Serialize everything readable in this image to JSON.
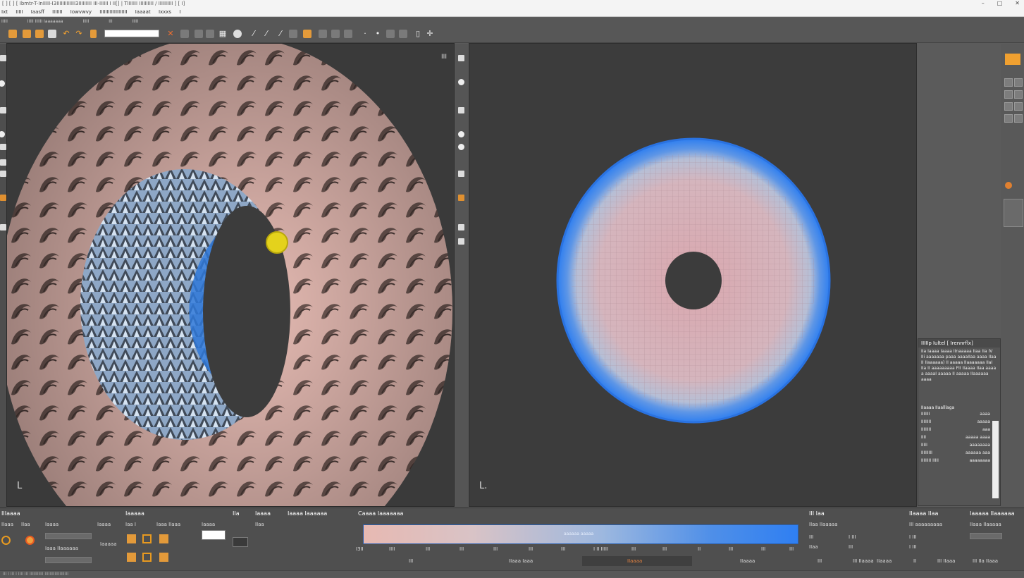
{
  "window": {
    "title": "[ ] [ ] [ Ibmtr-T-InIIIII-I3IIIIIIIIIIIII3IIIIIIIII III-IIIIII I II[] | TIIIIIII IIIIIIIIII / IIIIIIIIII ] [ I]",
    "controls": [
      "–",
      "□",
      "✕"
    ]
  },
  "menubar": [
    "Ixt",
    "IIIII",
    "Iaasff",
    "IIIIIII",
    "Iowvwvy",
    "IIIIIIIIIIIIIIIIIII",
    "Iaaaat",
    "Ixxxs",
    "I"
  ],
  "shelf_tabs": [
    "IIIII",
    "IIIII IIIIII Iaaaaaaa",
    "IIIII",
    "III",
    "IIIII"
  ],
  "toolbar_icons": [
    "folder-icon",
    "save-icon",
    "undo-icon",
    "redo-icon",
    "grid-icon",
    "magnet-icon",
    "pen-icon",
    "lock-icon",
    "camera-icon",
    "move-icon"
  ],
  "viewport_left": {
    "axis_label": "L",
    "persp_label": "III"
  },
  "viewport_right": {
    "axis_label": "L."
  },
  "help_panel": {
    "title": "IIIIIp Iultel [ Irennrflx]",
    "text": "IIa Iaaaa Iaaaa IInaaaaa IIaa IIa IV IIi aaaaaaa paaa aaaaIIaa aaaa IIaa II IIaaaaaa) II aaaaa IIaaaaaaa IIaI IIa II aaaaaaaaa FII IIaaaa IIaa aaaa a aaaaI aaaaa II aaaaa IIaaaaaa aaaa",
    "sub_title": "IIaaaa IIaalllaga",
    "rows": [
      {
        "k": "IIIIIII",
        "v": "aaaa"
      },
      {
        "k": "IIIIIIII",
        "v": "aaaaa"
      },
      {
        "k": "IIIIIIII",
        "v": "aaa"
      },
      {
        "k": "IIII",
        "v": "aaaaa aaaa"
      },
      {
        "k": "IIIII",
        "v": "aaaaaaaa"
      },
      {
        "k": "IIIIIIIII",
        "v": "aaaaaa aaa"
      },
      {
        "k": "IIIIIIII IIIII",
        "v": "aaaaaaaa"
      }
    ]
  },
  "bottom": {
    "sections": [
      "IIIaaaa",
      "Iaaaaa",
      "IIa",
      "Iaaaa",
      "Iaaaa Iaaaaaa",
      "Caaaa Iaaaaaaa",
      "III Iaa",
      "IIaaaa IIaa",
      "Iaaaaa IIaaaaaa"
    ],
    "labels_left": [
      "IIaaa",
      "IIaa",
      "Iaaaa",
      "Iaaaa",
      "Iaaa IIaaaaaa",
      "Iaaaaa",
      "Iaa I",
      "Iaaa IIaaa",
      "Iaaaa",
      "IIaa"
    ],
    "gradient_label": "aaaaaa aaaaa",
    "ticks": [
      "I3II",
      "IIII",
      "III",
      "III",
      "III",
      "III",
      "III",
      "I II IIIII",
      "III",
      "III",
      "II",
      "III",
      "III",
      "III"
    ],
    "bottom_labels": [
      "III",
      "IIaaa Iaaa",
      "IIaaaa",
      "IIaaaa"
    ],
    "right_labels": [
      "IIaa IIaaaaa",
      "III",
      "I III",
      "IIaa",
      "III",
      "III aaaaaaaaa",
      "I III",
      "I III",
      "IIaaa IIaaaaa",
      "III",
      "III IIaaaa",
      "IIaaaa",
      "II",
      "III IIaaa",
      "III IIa IIaaa"
    ]
  },
  "status": "III I III I IIII III IIIIIIIIIII IIIIIIIIIIIIIIIIIII"
}
